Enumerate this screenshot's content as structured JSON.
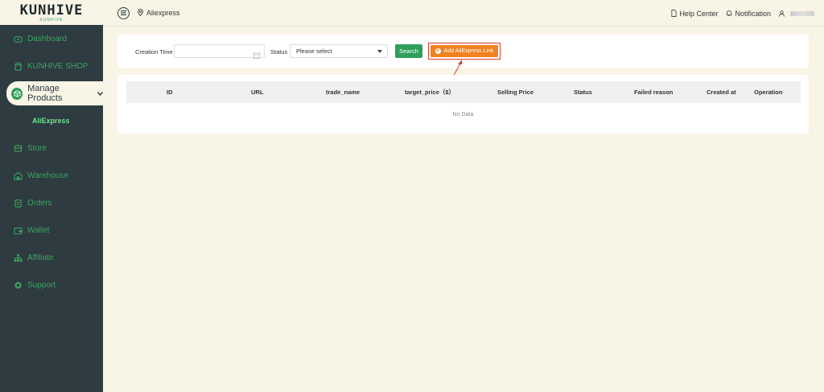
{
  "logo": {
    "text": "KUNHIVE",
    "sub": "KUNHIVE"
  },
  "sidebar": {
    "items": [
      {
        "label": "Dashboard",
        "icon": "dashboard-icon"
      },
      {
        "label": "KUNHIVE SHOP",
        "icon": "shop-icon"
      },
      {
        "label": "Manage Products",
        "icon": "box-icon",
        "active": true
      },
      {
        "label": "AliExpress",
        "sub": true
      },
      {
        "label": "Store",
        "icon": "store-icon"
      },
      {
        "label": "Warehouse",
        "icon": "warehouse-icon"
      },
      {
        "label": "Orders",
        "icon": "orders-icon"
      },
      {
        "label": "Wallet",
        "icon": "wallet-icon"
      },
      {
        "label": "Affiliate",
        "icon": "affiliate-icon"
      },
      {
        "label": "Support",
        "icon": "support-icon"
      }
    ]
  },
  "topbar": {
    "breadcrumb": "Aliexpress",
    "help": "Help Center",
    "notification": "Notification"
  },
  "filter": {
    "creation_time_label": "Creation Time",
    "status_label": "Status",
    "status_placeholder": "Please select",
    "search_label": "Search",
    "add_label": "Add AliExpress Link"
  },
  "table": {
    "columns": [
      "ID",
      "URL",
      "trade_name",
      "target_price（$）",
      "Selling Price",
      "Status",
      "Failed reason",
      "Created at",
      "Operation"
    ],
    "empty_text": "No Data"
  },
  "colors": {
    "sidebar": "#2e3b40",
    "accent_green": "#2f9e5a",
    "add_orange": "#f0821f",
    "highlight_red": "#e03a2b",
    "background": "#f8f4e6"
  }
}
